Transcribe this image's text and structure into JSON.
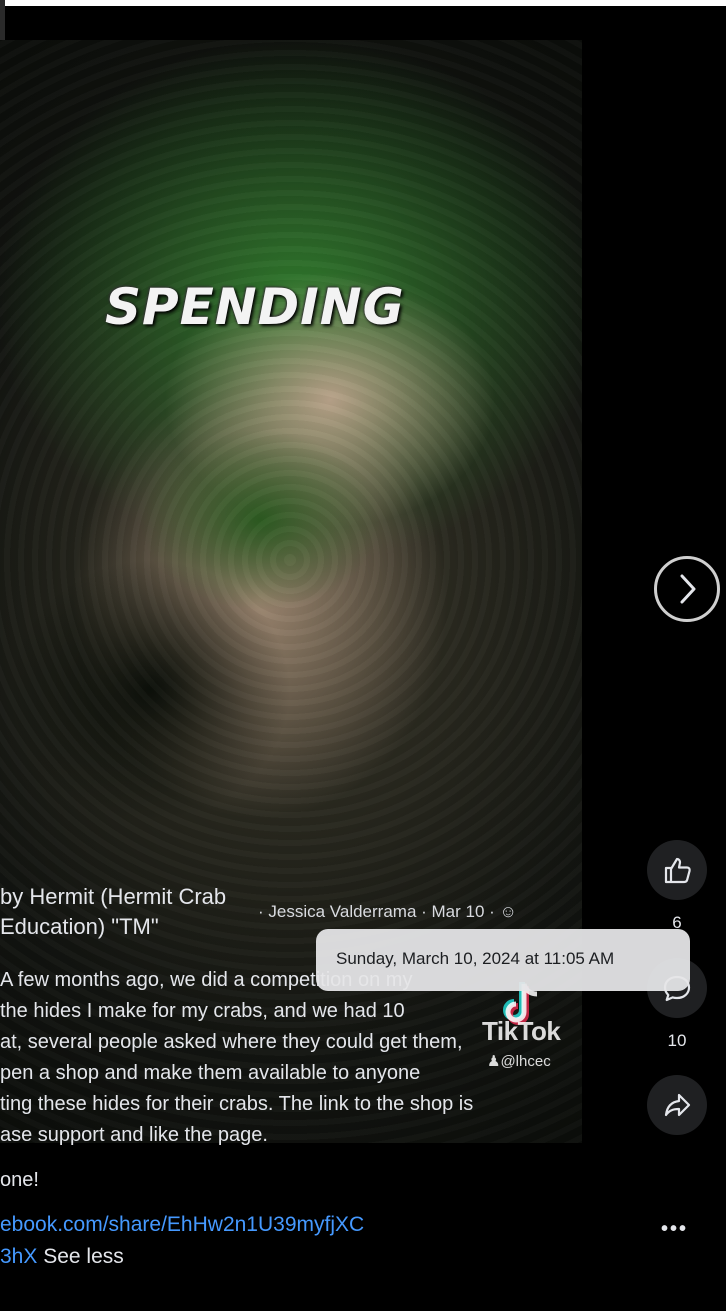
{
  "video": {
    "overlay_text": "SPENDING",
    "watermark": {
      "brand": "TikTok",
      "handle": "@lhcec"
    }
  },
  "post": {
    "author_line1": "by Hermit (Hermit Crab",
    "author_line2": "Education) \"TM\"",
    "meta": "· Jessica Valderrama · Mar 10 ·",
    "audience_icon": "globe-icon",
    "tooltip": "Sunday, March 10, 2024 at 11:05 AM",
    "caption_lines": [
      "A few months ago, we did a competition on my",
      "the hides I make for my crabs, and we had 10",
      "at, several people asked where they could get them,",
      "pen a shop and make them available to anyone",
      "ting these hides for their crabs. The link to the shop is",
      "ase support and like the page."
    ],
    "closing_line": "one!",
    "link_line1": "ebook.com/share/EhHw2n1U39myfjXC",
    "link_line2": "3hX",
    "see_less": "See less"
  },
  "actions": {
    "like_count": "6",
    "comment_count": "10",
    "more_label": "•••"
  },
  "icons": {
    "next": "chevron-right-icon",
    "like": "thumbs-up-icon",
    "comment": "comment-icon",
    "share": "share-icon"
  }
}
